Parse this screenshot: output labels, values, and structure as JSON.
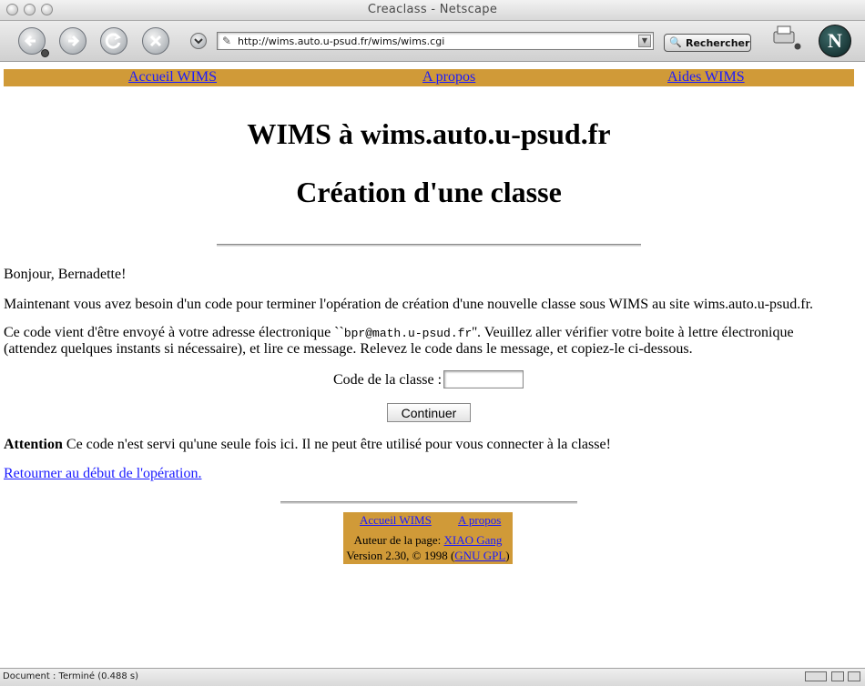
{
  "window": {
    "title": "Creaclass - Netscape"
  },
  "toolbar": {
    "url": "http://wims.auto.u-psud.fr/wims/wims.cgi",
    "search_label": "Rechercher",
    "logo_letter": "N"
  },
  "nav": {
    "home": "Accueil WIMS",
    "about": "A propos",
    "help": "Aides WIMS"
  },
  "page": {
    "title1": "WIMS à wims.auto.u-psud.fr",
    "title2": "Création d'une classe",
    "greeting": "Bonjour, Bernadette!",
    "intro": "Maintenant vous avez besoin d'un code pour terminer l'opération de création d'une nouvelle classe sous WIMS au site wims.auto.u-psud.fr.",
    "email_pre": "Ce code vient d'être envoyé à votre adresse électronique ``",
    "email": "bpr@math.u-psud.fr",
    "email_post": "''. Veuillez aller vérifier votre boite à lettre électronique (attendez quelques instants si nécessaire), et lire ce message. Relevez le code dans le message, et copiez-le ci-dessous.",
    "code_label": "Code de la classe :",
    "code_value": "",
    "continue_label": "Continuer",
    "attention_bold": "Attention",
    "attention_text": " Ce code n'est servi qu'une seule fois ici. Il ne peut être utilisé pour vous connecter à la classe!",
    "back_link": "Retourner au début de l'opération."
  },
  "footer": {
    "home": "Accueil WIMS",
    "about": "A propos",
    "author_label": "Auteur de la page: ",
    "author_name": "XIAO Gang",
    "version_text": "Version 2.30, © 1998 (",
    "license": "GNU GPL",
    "version_close": ")"
  },
  "status": {
    "text": "Document : Terminé (0.488 s)"
  },
  "colors": {
    "nav_bg": "#d09a38",
    "link": "#1a1aff"
  }
}
